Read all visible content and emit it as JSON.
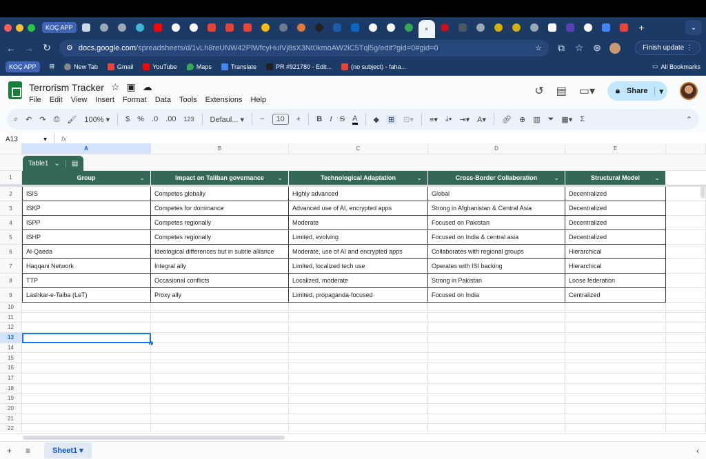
{
  "browser": {
    "app_chip": "KOÇ APP",
    "tab_close": "×",
    "new_tab": "+",
    "url_domain": "docs.google.com",
    "url_path": "/spreadsheets/d/1vLh8reUNW42PlWfcyHuIVj8sX3Nt0kmoAW2iC5Tql5g/edit?gid=0#gid=0",
    "finish_update": "Finish update",
    "bookmarks": [
      {
        "label": "KOÇ APP",
        "color": "#3f63b5"
      },
      {
        "label": "New Tab",
        "color": "#888888"
      },
      {
        "label": "Gmail",
        "color": "#ea4335"
      },
      {
        "label": "YouTube",
        "color": "#ff0000"
      },
      {
        "label": "Maps",
        "color": "#34a853"
      },
      {
        "label": "Translate",
        "color": "#4285f4"
      },
      {
        "label": "PR #921780 - Edit...",
        "color": "#222222"
      },
      {
        "label": "(no subject) - faha...",
        "color": "#ea4335"
      }
    ],
    "all_bookmarks": "All Bookmarks"
  },
  "doc": {
    "title": "Terrorism Tracker",
    "menus": [
      "File",
      "Edit",
      "View",
      "Insert",
      "Format",
      "Data",
      "Tools",
      "Extensions",
      "Help"
    ],
    "share_label": "Share"
  },
  "toolbar": {
    "zoom": "100%",
    "currency": "$",
    "percent": "%",
    "dec_dec": ".0",
    "dec_inc": ".00",
    "number_format": "123",
    "font": "Defaul...",
    "font_size": "10",
    "minus": "−",
    "plus": "+"
  },
  "formula_bar": {
    "name_box": "A13",
    "fx": "fx",
    "value": ""
  },
  "grid": {
    "columns": [
      "A",
      "B",
      "C",
      "D",
      "E"
    ],
    "table_name": "Table1",
    "headers": [
      "Group",
      "Impact on Taliban governance",
      "Technological Adaptation",
      "Cross-Border Collaboration",
      "Structural Model"
    ],
    "rows": [
      [
        "ISIS",
        "Competes globally",
        "Highly advanced",
        "Global",
        "Decentralized"
      ],
      [
        "ISKP",
        "Competes for dominance",
        "Advanced use of AI, encrypted apps",
        "Strong in Afghanistan & Central Asia",
        "Decentralized"
      ],
      [
        "ISPP",
        "Competes regionally",
        "Moderate",
        "Focused on Pakistan",
        "Decentralized"
      ],
      [
        "ISHP",
        "Competes regionally",
        "Limited, evolving",
        "Focused on India & central asia",
        "Decentralized"
      ],
      [
        "Al-Qaeda",
        "Ideological differences but in subtle alliance",
        "Moderate, use of AI and encrypted apps",
        "Collaborates with regional groups",
        "Hierarchical"
      ],
      [
        "Haqqani Network",
        "Integral ally",
        "Limited, localized tech use",
        "Operates with ISI backing",
        "Hierarchical"
      ],
      [
        "TTP",
        "Occasional conflicts",
        "Localized, moderate",
        "Strong in Pakistan",
        "Loose federation"
      ],
      [
        "Lashkar-e-Taiba (LeT)",
        "Proxy ally",
        "Limited, propaganda-focused",
        "Focused on India",
        "Centralized"
      ]
    ],
    "row_numbers": [
      "1",
      "2",
      "3",
      "4",
      "5",
      "6",
      "7",
      "8",
      "9",
      "10",
      "11",
      "12",
      "13",
      "14",
      "15",
      "16",
      "17",
      "18",
      "19",
      "20",
      "21",
      "22"
    ],
    "selected_cell": "A13"
  },
  "sheets": {
    "active": "Sheet1"
  },
  "colors": {
    "table_header": "#356854",
    "selection": "#1a73e8",
    "chrome_blue": "#1b3a66"
  }
}
